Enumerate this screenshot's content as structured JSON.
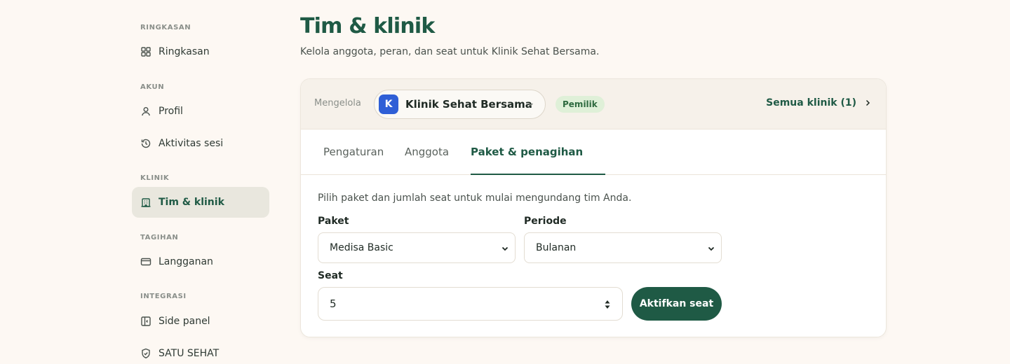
{
  "sidebar": {
    "sections": [
      {
        "label": "RINGKASAN",
        "items": [
          {
            "label": "Ringkasan",
            "icon": "grid-icon"
          }
        ]
      },
      {
        "label": "AKUN",
        "items": [
          {
            "label": "Profil",
            "icon": "user-icon"
          },
          {
            "label": "Aktivitas sesi",
            "icon": "history-icon"
          }
        ]
      },
      {
        "label": "KLINIK",
        "items": [
          {
            "label": "Tim & klinik",
            "icon": "building-icon",
            "active": true
          }
        ]
      },
      {
        "label": "TAGIHAN",
        "items": [
          {
            "label": "Langganan",
            "icon": "credit-card-icon"
          }
        ]
      },
      {
        "label": "INTEGRASI",
        "items": [
          {
            "label": "Side panel",
            "icon": "side-panel-icon"
          },
          {
            "label": "SATU SEHAT",
            "icon": "shield-check-icon"
          }
        ]
      }
    ]
  },
  "page": {
    "title": "Tim & klinik",
    "subtitle": "Kelola anggota, peran, dan seat untuk Klinik Sehat Bersama."
  },
  "header": {
    "manage_label": "Mengelola",
    "clinic_initial": "K",
    "clinic_name": "Klinik Sehat Bersama",
    "role_badge": "Pemilik",
    "all_clinics": "Semua klinik (1)"
  },
  "tabs": [
    {
      "label": "Pengaturan",
      "active": false
    },
    {
      "label": "Anggota",
      "active": false
    },
    {
      "label": "Paket & penagihan",
      "active": true
    }
  ],
  "billing": {
    "intro": "Pilih paket dan jumlah seat untuk mulai mengundang tim Anda.",
    "plan_label": "Paket",
    "plan_value": "Medisa Basic",
    "period_label": "Periode",
    "period_value": "Bulanan",
    "seat_label": "Seat",
    "seat_value": "5",
    "activate_button": "Aktifkan seat"
  },
  "colors": {
    "background": "#fdf8f3",
    "accent": "#1f5a45",
    "active_nav_bg": "#e9e7de",
    "clinic_avatar": "#2f5fd6",
    "badge_bg": "#dff0d8"
  }
}
